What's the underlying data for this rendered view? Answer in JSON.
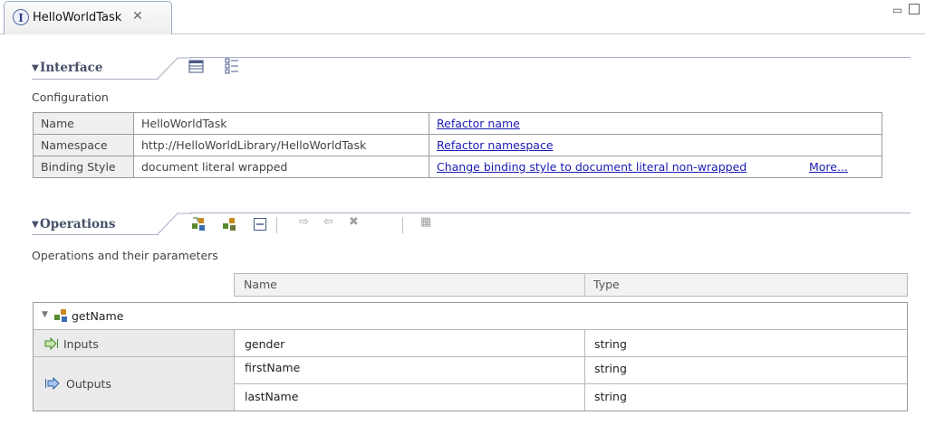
{
  "tab": {
    "title": "HelloWorldTask",
    "close_glyph": "✕",
    "icon": "interface-icon"
  },
  "window_controls": {
    "minimize_glyph": "▭"
  },
  "interface_section": {
    "title": "Interface",
    "description": "Configuration",
    "rows": [
      {
        "key": "Name",
        "value": "HelloWorldTask",
        "link": "Refactor name",
        "extra": ""
      },
      {
        "key": "Namespace",
        "value": "http://HelloWorldLibrary/HelloWorldTask",
        "link": "Refactor namespace",
        "extra": ""
      },
      {
        "key": "Binding Style",
        "value": "document literal wrapped",
        "link": "Change binding style to document literal non-wrapped",
        "extra": "More..."
      }
    ]
  },
  "operations_section": {
    "title": "Operations",
    "description": "Operations and their parameters",
    "columns": {
      "name": "Name",
      "type": "Type"
    },
    "operation": {
      "name": "getName"
    },
    "inputs_label": "Inputs",
    "outputs_label": "Outputs",
    "inputs": [
      {
        "name": "gender",
        "type": "string"
      }
    ],
    "outputs": [
      {
        "name": "firstName",
        "type": "string"
      },
      {
        "name": "lastName",
        "type": "string"
      }
    ]
  },
  "colors": {
    "accent": "#465069",
    "link": "#1b1bb5",
    "tab_border": "#9aa9c4"
  }
}
